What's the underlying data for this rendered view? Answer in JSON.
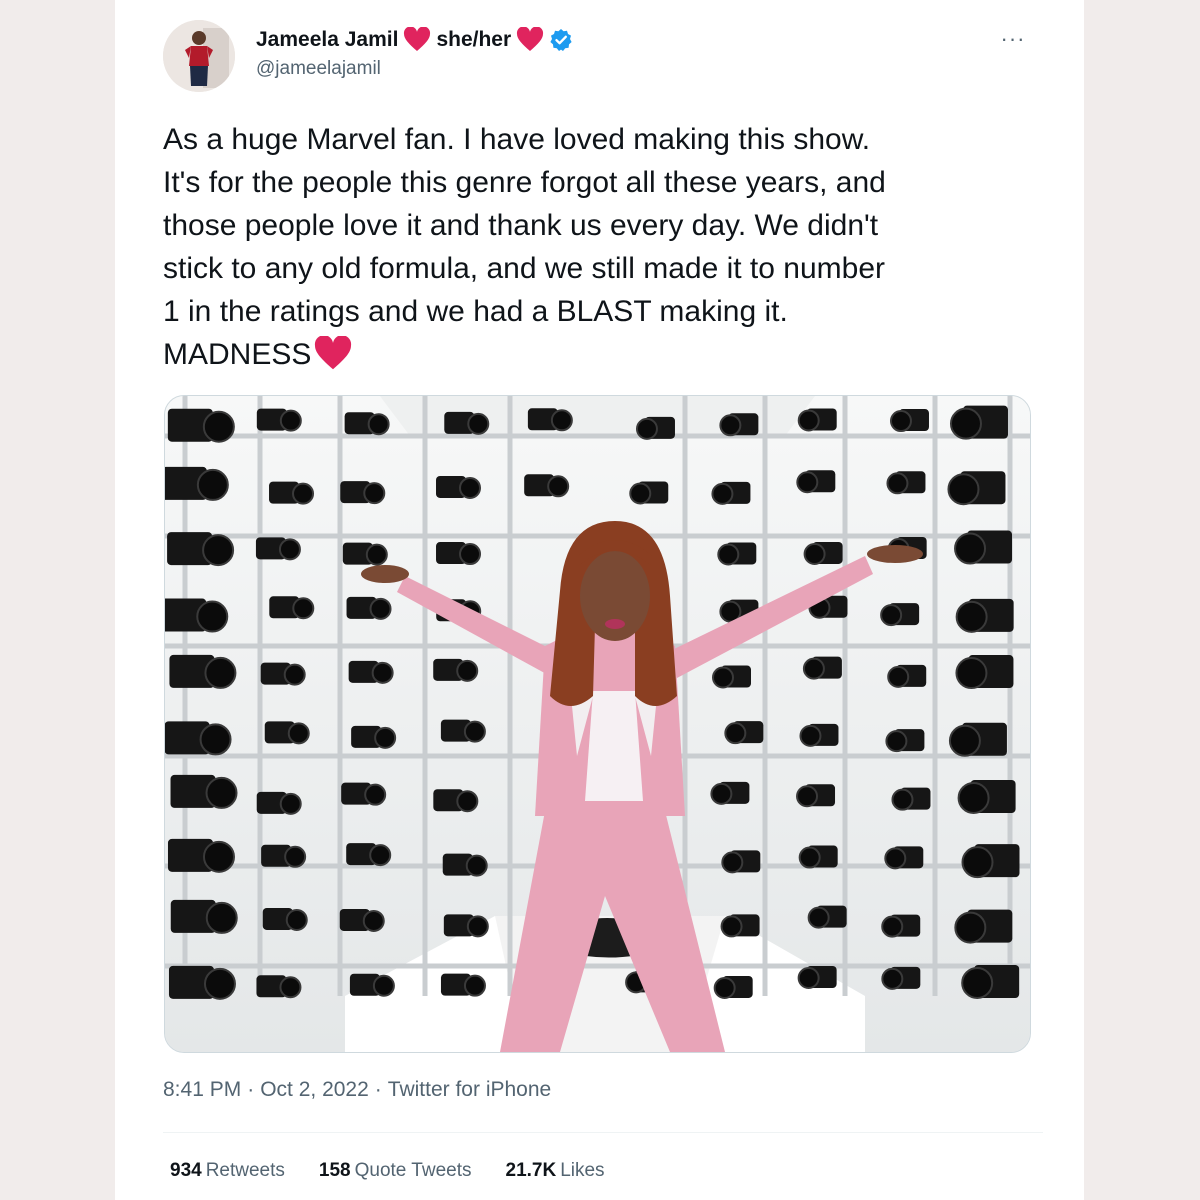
{
  "author": {
    "name": "Jameela Jamil",
    "pronouns": "she/her",
    "handle": "@jameelajamil",
    "verified": true
  },
  "menu": {
    "more_label": "···"
  },
  "tweet": {
    "lines": [
      "As a huge Marvel fan. I have loved making this show.",
      "It's for the people this genre forgot all these years, and",
      "those people love it and thank us every day. We didn't",
      "stick to any old formula, and we still made it to number",
      "1 in the ratings and we had a BLAST making it.",
      "MADNESS"
    ]
  },
  "photo": {
    "subject": "woman in pink suit posing with arms outstretched inside a camera rig surrounded by many cameras"
  },
  "meta": {
    "time": "8:41 PM",
    "sep1": "·",
    "date": "Oct 2, 2022",
    "sep2": "·",
    "source": "Twitter for iPhone"
  },
  "stats": {
    "retweets_count": "934",
    "retweets_label": "Retweets",
    "quotes_count": "158",
    "quotes_label": "Quote Tweets",
    "likes_count": "21.7K",
    "likes_label": "Likes"
  },
  "colors": {
    "heart": "#e0245e",
    "verified": "#1d9bf0",
    "suit": "#e8a4b8",
    "page_bg": "#f1eceb"
  },
  "icons": {
    "heart": "red-heart-icon",
    "verified": "verified-badge-icon",
    "more": "more-icon"
  }
}
